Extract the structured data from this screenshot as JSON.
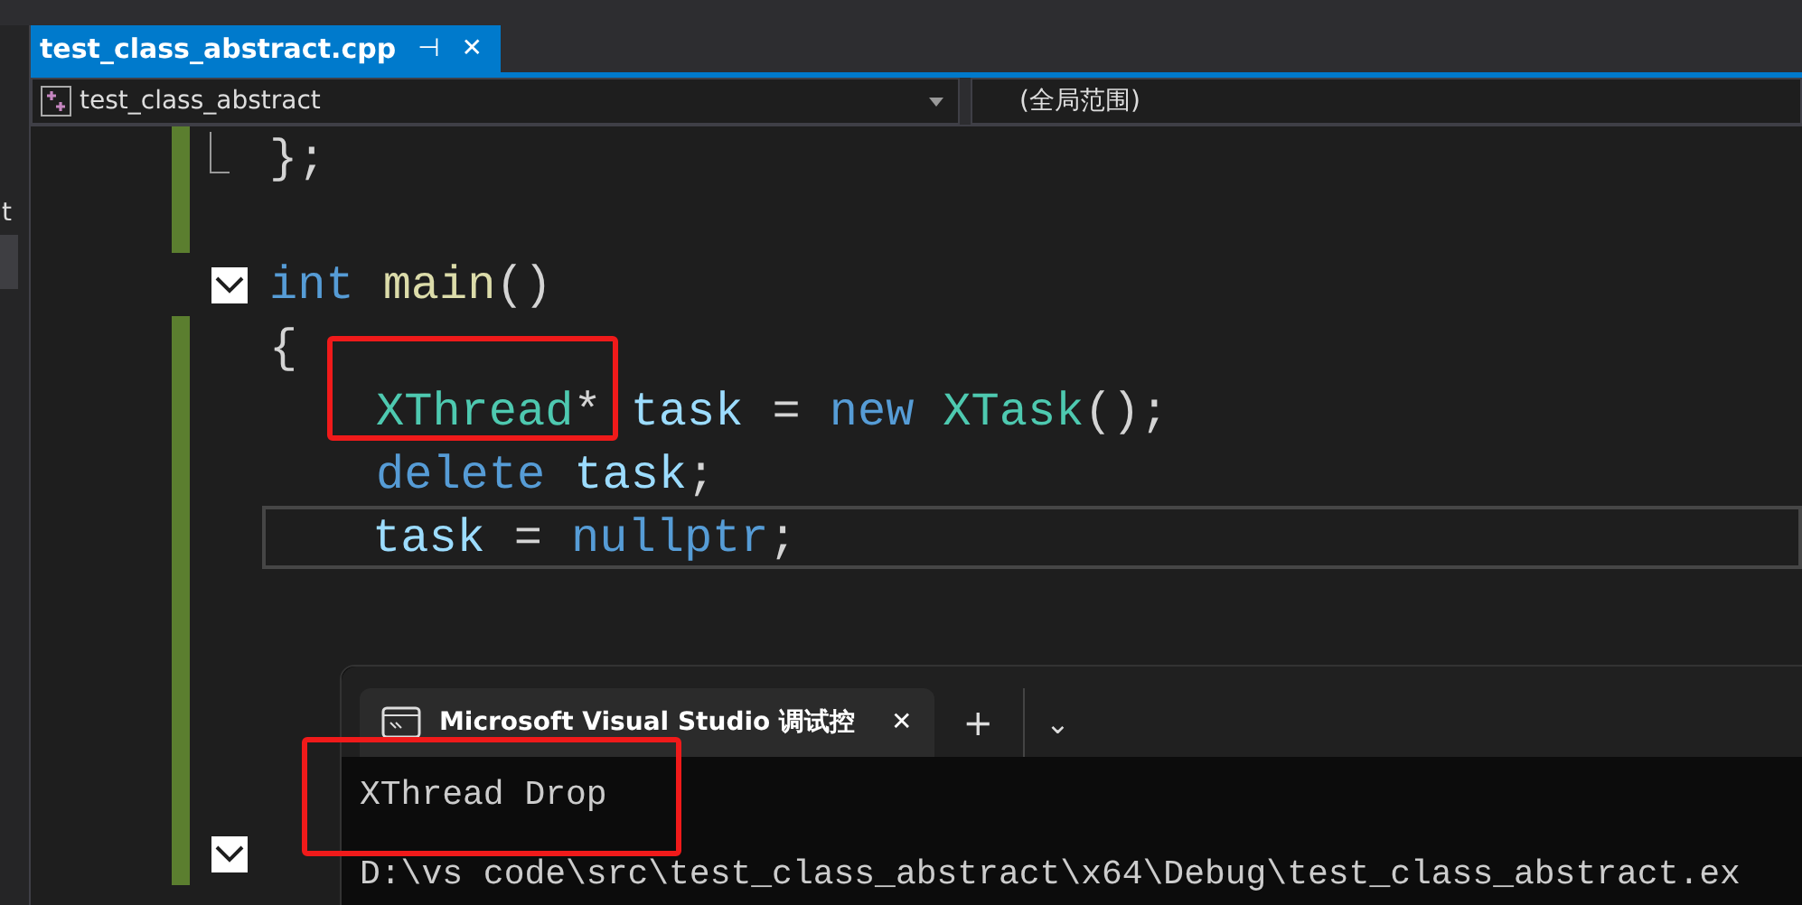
{
  "sidebar": {
    "fragment": "t"
  },
  "tabs": [
    {
      "label": "test_class_abstract.cpp",
      "pin": "⊣",
      "close": "✕",
      "selected": true
    }
  ],
  "navbar": {
    "project": "test_class_abstract",
    "scope": "(全局范围)"
  },
  "code": {
    "lines": [
      {
        "changed": true,
        "fold_end": true,
        "tokens": [
          {
            "kind": "punct",
            "text": "};"
          }
        ]
      },
      {
        "changed": true
      },
      {
        "changed": false,
        "collapsible": true,
        "tokens": [
          {
            "kind": "keyword",
            "text": "int"
          },
          {
            "kind": "function",
            "text": "main"
          },
          {
            "kind": "punct",
            "text": "()"
          }
        ]
      },
      {
        "changed": true,
        "tokens": [
          {
            "kind": "punct",
            "text": "{"
          }
        ],
        "children": [
          {
            "changed": true,
            "tokens": [
              {
                "kind": "type",
                "text": "XThread"
              },
              {
                "kind": "punct",
                "text": "*"
              },
              {
                "kind": "variable",
                "text": "task"
              },
              {
                "kind": "operator",
                "text": "="
              },
              {
                "kind": "keyword",
                "text": "new"
              },
              {
                "kind": "type",
                "text": "XTask"
              },
              {
                "kind": "punct",
                "text": "();"
              }
            ]
          },
          {
            "changed": true,
            "tokens": [
              {
                "kind": "keyword",
                "text": "delete"
              },
              {
                "kind": "variable",
                "text": "task"
              },
              {
                "kind": "punct",
                "text": ";"
              }
            ]
          },
          {
            "changed": true,
            "current": true,
            "tokens": [
              {
                "kind": "variable",
                "text": "task"
              },
              {
                "kind": "operator",
                "text": "="
              },
              {
                "kind": "keyword",
                "text": "nullptr"
              },
              {
                "kind": "punct",
                "text": ";"
              }
            ]
          },
          {
            "changed": true
          },
          {
            "changed": true
          },
          {
            "changed": true
          },
          {
            "changed": true
          }
        ]
      },
      {
        "changed": true,
        "collapsible": true
      }
    ]
  },
  "console": {
    "tab": {
      "title": "Microsoft Visual Studio 调试控",
      "close": "✕",
      "selected": true
    },
    "new_tab": "+",
    "dropdown": "⌄",
    "output": [
      "XThread Drop",
      "D:\\vs code\\src\\test_class_abstract\\x64\\Debug\\test_class_abstract.ex"
    ]
  }
}
